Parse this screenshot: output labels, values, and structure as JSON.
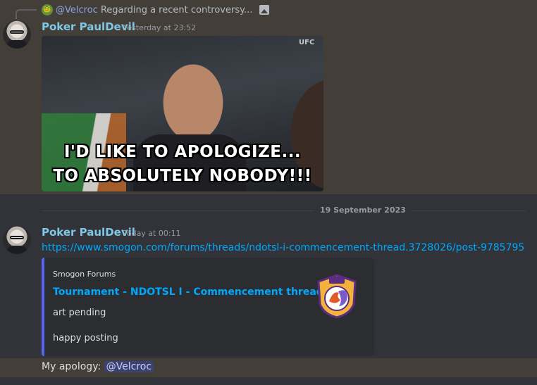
{
  "reply": {
    "user": "@Velcroc",
    "text": "Regarding a recent controversy..."
  },
  "messages": [
    {
      "username": "Poker PaulDevil",
      "timestamp": "Yesterday at 23:52",
      "gif": {
        "caption_line1": "I'D LIKE TO APOLOGIZE...",
        "caption_line2": "TO ABSOLUTELY NOBODY!!!",
        "badge": "UFC"
      }
    },
    {
      "username": "Poker PaulDevil",
      "timestamp": "Today at 00:11",
      "link": "https://www.smogon.com/forums/threads/ndotsl-i-commencement-thread.3728026/post-9785795",
      "embed": {
        "provider": "Smogon Forums",
        "title": "Tournament - NDOTSL I - Commencement thread",
        "line1": "art pending",
        "line2": "happy posting",
        "accent_color": "#5865f2"
      }
    }
  ],
  "date_divider": "19 September 2023",
  "apology": {
    "prefix": "My apology:",
    "mention": "@Velcroc"
  },
  "icons": [
    "reply-avatar-icon",
    "image-icon",
    "user-avatar",
    "smogon-logo"
  ],
  "colors": {
    "background": "#313338",
    "highlight": "#433f38",
    "username": "#7fc8e6",
    "link": "#00a8fc",
    "mention_bg": "#3c4270"
  }
}
